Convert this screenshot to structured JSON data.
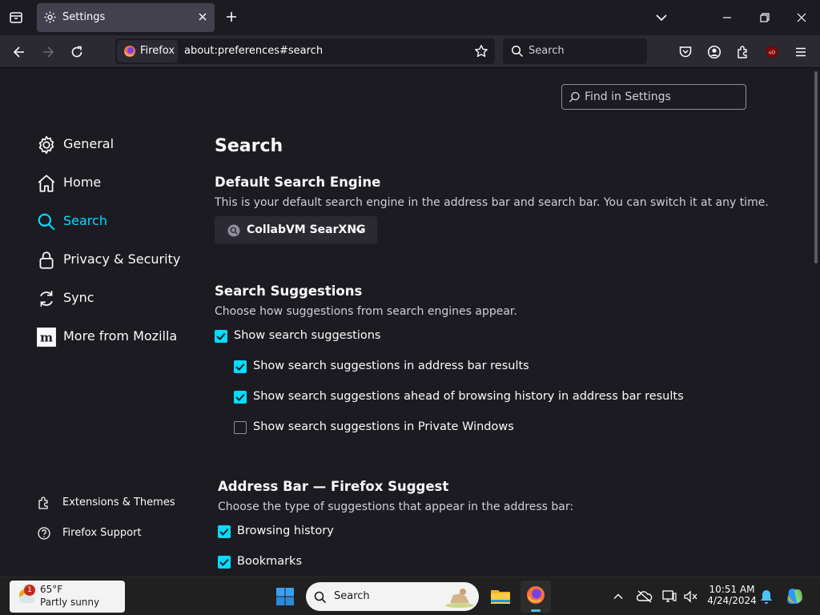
{
  "browser": {
    "tab": {
      "title": "Settings"
    },
    "identity_label": "Firefox",
    "url": "about:preferences#search",
    "searchbar_placeholder": "Search"
  },
  "settings": {
    "find_placeholder": "Find in Settings",
    "categories": [
      {
        "label": "General",
        "icon": "gear-icon"
      },
      {
        "label": "Home",
        "icon": "home-icon"
      },
      {
        "label": "Search",
        "icon": "search-icon",
        "active": true
      },
      {
        "label": "Privacy & Security",
        "icon": "lock-icon"
      },
      {
        "label": "Sync",
        "icon": "sync-icon"
      },
      {
        "label": "More from Mozilla",
        "icon": "mozilla-icon"
      }
    ],
    "footer": [
      {
        "label": "Extensions & Themes",
        "icon": "puzzle-icon"
      },
      {
        "label": "Firefox Support",
        "icon": "help-icon"
      }
    ],
    "page_title": "Search",
    "default_engine": {
      "heading": "Default Search Engine",
      "description": "This is your default search engine in the address bar and search bar. You can switch it at any time.",
      "selected": "CollabVM SearXNG"
    },
    "suggestions": {
      "heading": "Search Suggestions",
      "description": "Choose how suggestions from search engines appear.",
      "items": [
        {
          "label": "Show search suggestions",
          "checked": true
        },
        {
          "label": "Show search suggestions in address bar results",
          "checked": true
        },
        {
          "label": "Show search suggestions ahead of browsing history in address bar results",
          "checked": true
        },
        {
          "label": "Show search suggestions in Private Windows",
          "checked": false
        }
      ]
    },
    "address_bar": {
      "heading": "Address Bar — Firefox Suggest",
      "description": "Choose the type of suggestions that appear in the address bar:",
      "items": [
        {
          "label": "Browsing history",
          "checked": true
        },
        {
          "label": "Bookmarks",
          "checked": true
        }
      ]
    }
  },
  "taskbar": {
    "weather": {
      "temp": "65°F",
      "condition": "Partly sunny",
      "badge": "1"
    },
    "search_placeholder": "Search",
    "time": "10:51 AM",
    "date": "4/24/2024"
  },
  "colors": {
    "accent": "#00ddff",
    "background": "#1c1b22",
    "toolbar": "#2b2a33"
  }
}
